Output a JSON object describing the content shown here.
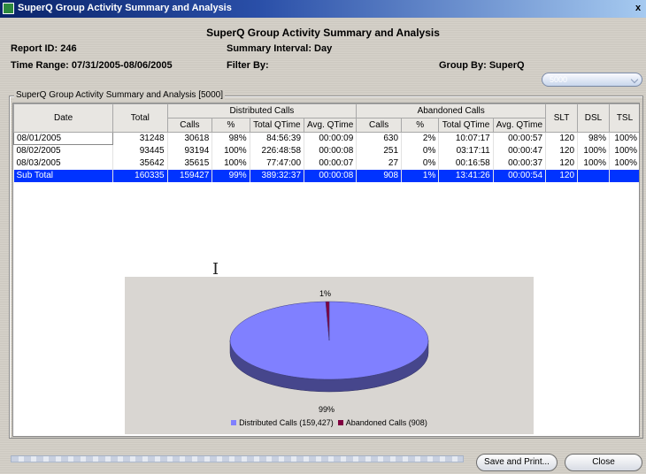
{
  "window": {
    "title": "SuperQ Group Activity Summary and Analysis",
    "close_glyph": "x"
  },
  "report": {
    "title": "SuperQ Group Activity Summary and Analysis",
    "report_id": "Report ID: 246",
    "summary_interval": "Summary Interval: Day",
    "time_range": "Time Range: 07/31/2005-08/06/2005",
    "filter_by": "Filter By:",
    "group_by": "Group By: SuperQ"
  },
  "combo": {
    "value": "5000"
  },
  "group_box": {
    "legend": "SuperQ Group Activity Summary and Analysis [5000]"
  },
  "table": {
    "headers": {
      "date": "Date",
      "total": "Total",
      "distributed": "Distributed Calls",
      "abandoned": "Abandoned Calls",
      "calls": "Calls",
      "pct": "%",
      "total_qtime": "Total QTime",
      "avg_qtime": "Avg. QTime",
      "slt": "SLT",
      "dsl": "DSL",
      "tsl": "TSL"
    },
    "rows": [
      {
        "date": "08/01/2005",
        "total": "31248",
        "d_calls": "30618",
        "d_pct": "98%",
        "d_tq": "84:56:39",
        "d_aq": "00:00:09",
        "a_calls": "630",
        "a_pct": "2%",
        "a_tq": "10:07:17",
        "a_aq": "00:00:57",
        "slt": "120",
        "dsl": "98%",
        "tsl": "100%"
      },
      {
        "date": "08/02/2005",
        "total": "93445",
        "d_calls": "93194",
        "d_pct": "100%",
        "d_tq": "226:48:58",
        "d_aq": "00:00:08",
        "a_calls": "251",
        "a_pct": "0%",
        "a_tq": "03:17:11",
        "a_aq": "00:00:47",
        "slt": "120",
        "dsl": "100%",
        "tsl": "100%"
      },
      {
        "date": "08/03/2005",
        "total": "35642",
        "d_calls": "35615",
        "d_pct": "100%",
        "d_tq": "77:47:00",
        "d_aq": "00:00:07",
        "a_calls": "27",
        "a_pct": "0%",
        "a_tq": "00:16:58",
        "a_aq": "00:00:37",
        "slt": "120",
        "dsl": "100%",
        "tsl": "100%"
      }
    ],
    "subtotal": {
      "date": "Sub Total",
      "total": "160335",
      "d_calls": "159427",
      "d_pct": "99%",
      "d_tq": "389:32:37",
      "d_aq": "00:00:08",
      "a_calls": "908",
      "a_pct": "1%",
      "a_tq": "13:41:26",
      "a_aq": "00:00:54",
      "slt": "120",
      "dsl": "",
      "tsl": ""
    }
  },
  "chart_data": {
    "type": "pie",
    "slices": [
      {
        "name": "Distributed Calls (159,427)",
        "value": 159427,
        "pct_label": "99%",
        "color": "#8080ff"
      },
      {
        "name": "Abandoned Calls (908)",
        "value": 908,
        "pct_label": "1%",
        "color": "#800040"
      }
    ]
  },
  "buttons": {
    "save_print": "Save and Print...",
    "close": "Close"
  }
}
